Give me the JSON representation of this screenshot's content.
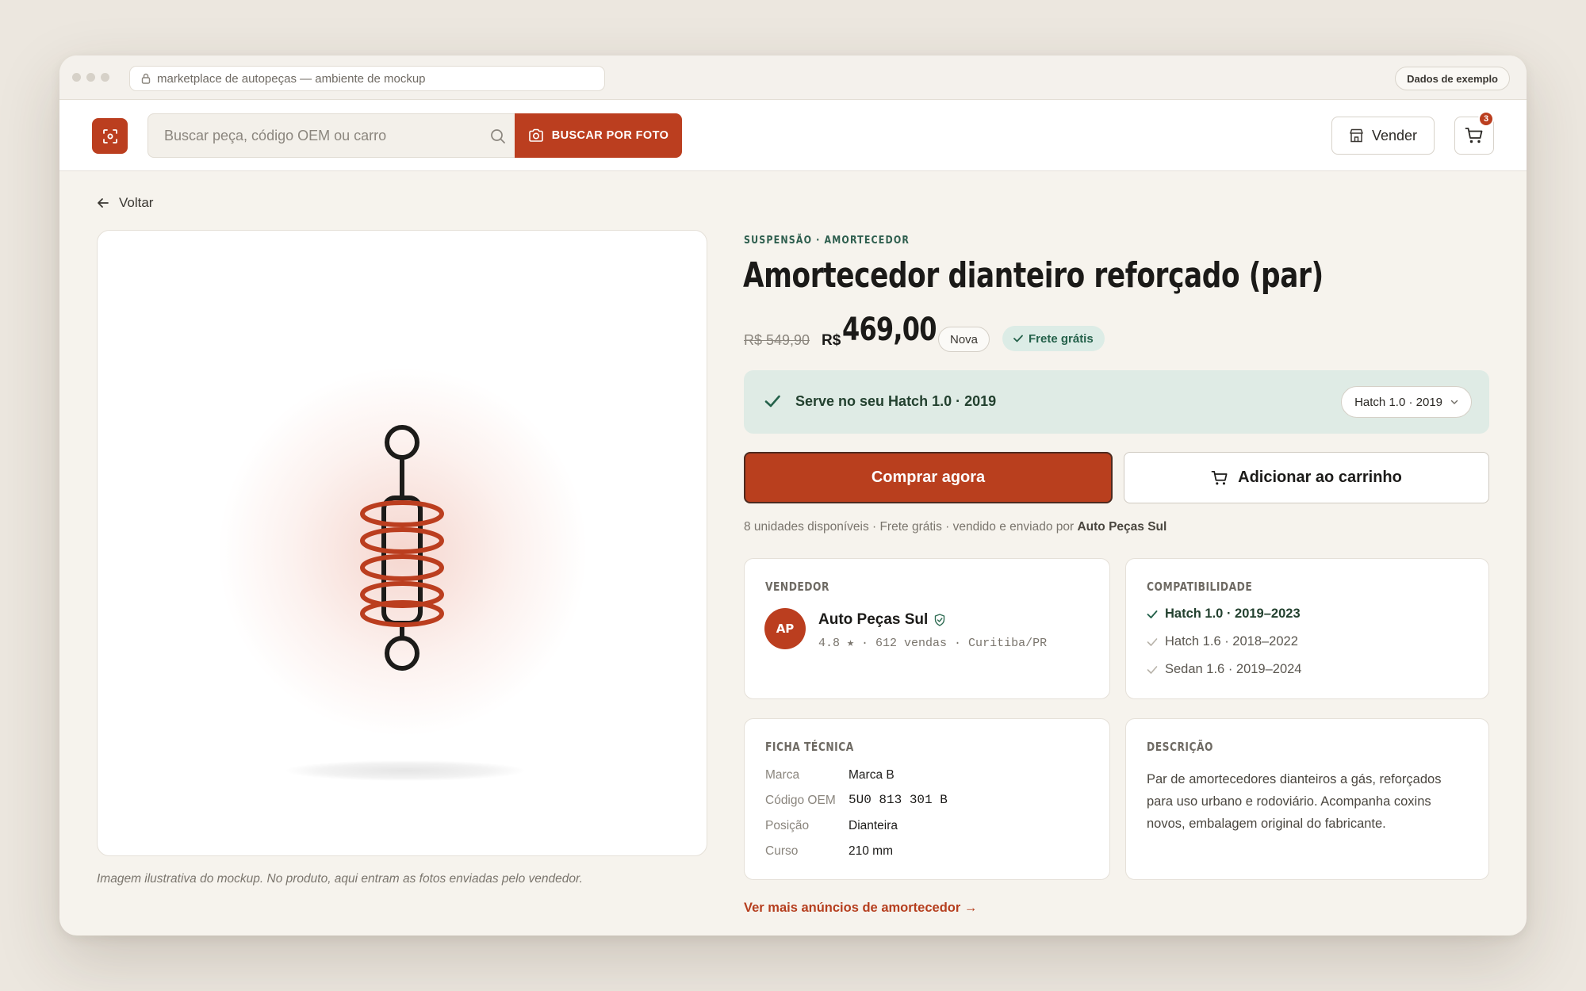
{
  "browser": {
    "url": "marketplace de autopeças — ambiente de mockup",
    "badge": "Dados de exemplo"
  },
  "header": {
    "search_placeholder": "Buscar peça, código OEM ou carro",
    "photo_search_label": "BUSCAR POR FOTO",
    "sell_label": "Vender",
    "cart_count": "3"
  },
  "nav": {
    "back_label": "Voltar"
  },
  "gallery": {
    "caption": "Imagem ilustrativa do mockup. No produto, aqui entram as fotos enviadas pelo vendedor."
  },
  "product": {
    "category": "SUSPENSÃO · AMORTECEDOR",
    "title": "Amortecedor dianteiro reforçado (par)",
    "old_price": "R$ 549,90",
    "currency": "R$",
    "price": "469,00",
    "condition": "Nova",
    "shipping_badge": "Frete grátis"
  },
  "fitment": {
    "message": "Serve no seu Hatch 1.0 · 2019",
    "selected_car": "Hatch 1.0 · 2019"
  },
  "actions": {
    "buy_label": "Comprar agora",
    "add_to_cart_label": "Adicionar ao carrinho"
  },
  "stock": {
    "text": "8 unidades disponíveis · Frete grátis · vendido e enviado por",
    "seller": "Auto Peças Sul"
  },
  "seller_card": {
    "label": "VENDEDOR",
    "initials": "AP",
    "name": "Auto Peças Sul",
    "meta": "4.8 ★ · 612 vendas · Curitiba/PR"
  },
  "compat_card": {
    "label": "COMPATIBILIDADE",
    "items": [
      {
        "text": "Hatch 1.0 · 2019–2023",
        "active": true
      },
      {
        "text": "Hatch 1.6 · 2018–2022",
        "active": false
      },
      {
        "text": "Sedan 1.6 · 2019–2024",
        "active": false
      }
    ]
  },
  "specs_card": {
    "label": "FICHA TÉCNICA",
    "rows": [
      {
        "key": "Marca",
        "value": "Marca B"
      },
      {
        "key": "Código OEM",
        "value": "5U0 813 301 B"
      },
      {
        "key": "Posição",
        "value": "Dianteira"
      },
      {
        "key": "Curso",
        "value": "210 mm"
      }
    ]
  },
  "desc_card": {
    "label": "DESCRIÇÃO",
    "text": "Par de amortecedores dianteiros a gás, reforçados para uso urbano e rodoviário. Acompanha coxins novos, embalagem original do fabricante."
  },
  "more_link": "Ver mais anúncios de amortecedor →",
  "colors": {
    "accent": "#bb3e1f",
    "success_bg": "#dfebe5",
    "success_text": "#23412f",
    "page_bg": "#f6f3ed"
  }
}
